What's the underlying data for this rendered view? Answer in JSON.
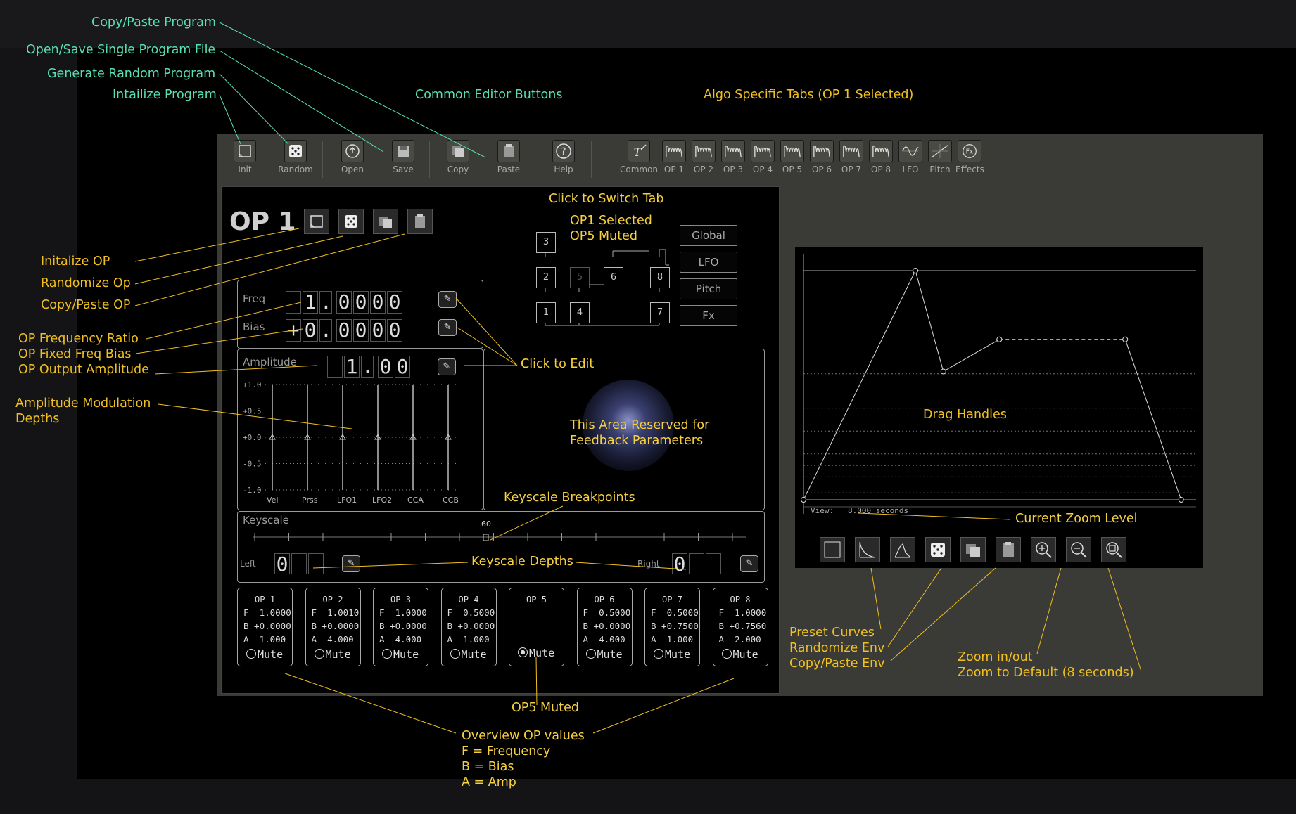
{
  "annotations": {
    "copy_paste_program": "Copy/Paste Program",
    "open_save_file": "Open/Save Single Program File",
    "generate_random": "Generate Random Program",
    "initialize_program": "Intailize Program",
    "common_editor_buttons": "Common Editor Buttons",
    "algo_tabs": "Algo Specific Tabs (OP 1 Selected)",
    "click_switch_tab": "Click to Switch Tab",
    "op1_selected": "OP1 Selected",
    "op5_muted_top": "OP5 Muted",
    "initialize_op": "Initalize OP",
    "randomize_op": "Randomize Op",
    "copy_paste_op": "Copy/Paste OP",
    "freq_ratio": "OP Frequency Ratio",
    "fixed_bias": "OP Fixed Freq Bias",
    "output_amp": "OP Output Amplitude",
    "amp_mod_1": "Amplitude Modulation",
    "amp_mod_2": "Depths",
    "click_to_edit": "Click to Edit",
    "reserved_1": "This Area Reserved for",
    "reserved_2": "Feedback Parameters",
    "keyscale_bp": "Keyscale Breakpoints",
    "keyscale_depths": "Keyscale Depths",
    "op5_muted_bottom": "OP5 Muted",
    "overview_1": "Overview OP values",
    "overview_2": "F = Frequency",
    "overview_3": "B = Bias",
    "overview_4": "A = Amp",
    "drag_handles": "Drag Handles",
    "zoom_level": "Current Zoom Level",
    "preset_curves": "Preset Curves",
    "randomize_env": "Randomize Env",
    "copy_paste_env": "Copy/Paste Env",
    "zoom_inout": "Zoom in/out",
    "zoom_default": "Zoom to Default (8 seconds)"
  },
  "toolbar": {
    "init": "Init",
    "random": "Random",
    "open": "Open",
    "save": "Save",
    "copy": "Copy",
    "paste": "Paste",
    "help": "Help",
    "common": "Common",
    "op1": "OP 1",
    "op2": "OP 2",
    "op3": "OP 3",
    "op4": "OP 4",
    "op5": "OP 5",
    "op6": "OP 6",
    "op7": "OP 7",
    "op8": "OP 8",
    "lfo": "LFO",
    "pitch": "Pitch",
    "effects": "Effects"
  },
  "op_editor": {
    "title": "OP 1",
    "freq_label": "Freq",
    "freq_digits": [
      "",
      "1",
      ".",
      "0",
      "0",
      "0",
      "0"
    ],
    "bias_label": "Bias",
    "bias_digits": [
      "+",
      "0",
      ".",
      "0",
      "0",
      "0",
      "0"
    ],
    "amp_label": "Amplitude",
    "amp_digits": [
      "",
      "1",
      ".",
      "0",
      "0"
    ],
    "amp_mod_ticks": [
      "+1.0",
      "+0.5",
      "+0.0",
      "-0.5",
      "-1.0"
    ],
    "amp_mod_sources": [
      "Vel",
      "Prss",
      "LFO1",
      "LFO2",
      "CCA",
      "CCB"
    ],
    "amp_mod_values": [
      0,
      0,
      0,
      0,
      0,
      0
    ],
    "keyscale_label": "Keyscale",
    "keyscale_breakpoint": "60",
    "keyscale_left_label": "Left",
    "keyscale_left_value": "0",
    "keyscale_right_label": "Right",
    "keyscale_right_value": "0"
  },
  "algo_tabs": {
    "ops": [
      "1",
      "2",
      "3",
      "4",
      "5",
      "6",
      "7",
      "8"
    ],
    "global": "Global",
    "lfo": "LFO",
    "pitch": "Pitch",
    "fx": "Fx"
  },
  "overview": [
    {
      "title": "OP 1",
      "f": "1.0000",
      "b": "+0.0000",
      "a": "1.000",
      "mute": "Mute",
      "muted": false
    },
    {
      "title": "OP 2",
      "f": "1.0010",
      "b": "+0.0000",
      "a": "4.000",
      "mute": "Mute",
      "muted": false
    },
    {
      "title": "OP 3",
      "f": "1.0000",
      "b": "+0.0000",
      "a": "4.000",
      "mute": "Mute",
      "muted": false
    },
    {
      "title": "OP 4",
      "f": "0.5000",
      "b": "+0.0000",
      "a": "1.000",
      "mute": "Mute",
      "muted": false
    },
    {
      "title": "OP 5",
      "f": "",
      "b": "",
      "a": "",
      "mute": "Mute",
      "muted": true
    },
    {
      "title": "OP 6",
      "f": "0.5000",
      "b": "+0.0000",
      "a": "4.000",
      "mute": "Mute",
      "muted": false
    },
    {
      "title": "OP 7",
      "f": "0.5000",
      "b": "+0.7500",
      "a": "1.000",
      "mute": "Mute",
      "muted": false
    },
    {
      "title": "OP 8",
      "f": "1.0000",
      "b": "+0.7560",
      "a": "2.000",
      "mute": "Mute",
      "muted": false
    }
  ],
  "envelope": {
    "view_label": "View:",
    "view_value": "8.000 seconds",
    "view_seconds": 8,
    "points": [
      [
        0,
        0
      ],
      [
        0.8,
        1.0
      ],
      [
        1.0,
        0.56
      ],
      [
        1.4,
        0.7
      ],
      [
        2.3,
        0.7
      ],
      [
        2.7,
        0
      ]
    ],
    "sustain_segment": [
      3,
      4
    ],
    "icons": [
      "curve-linear-icon",
      "curve-exp-icon",
      "curve-shape-icon",
      "dice-icon",
      "copy-icon",
      "paste-icon",
      "zoom-in-icon",
      "zoom-out-icon",
      "zoom-default-icon"
    ]
  },
  "colors": {
    "annotation_green": "#58e0b0",
    "annotation_orange": "#f0c020"
  }
}
